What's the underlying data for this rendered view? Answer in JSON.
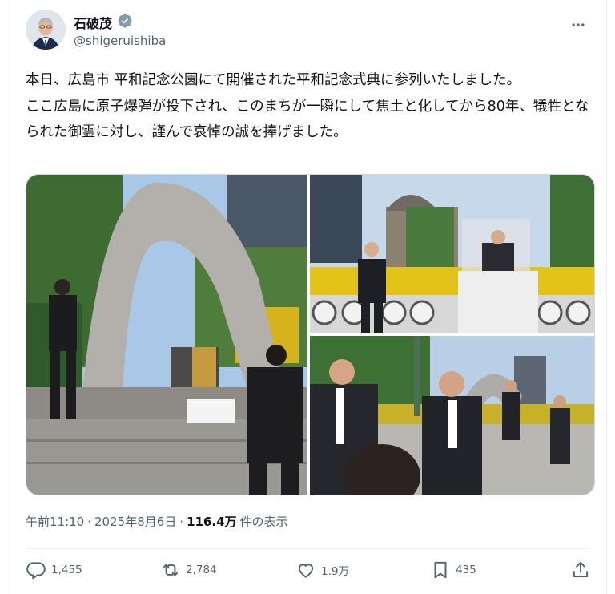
{
  "author": {
    "display_name": "石破茂",
    "handle": "@shigeruishiba",
    "verified_color": "#829aab",
    "avatar_icon": "profile-photo"
  },
  "tweet": {
    "text": "本日、広島市 平和記念公園にて開催された平和記念式典に参列いたしました。\nここ広島に原子爆弾が投下され、このまちが一瞬にして焦土と化してから80年、犠牲となられた御霊に対し、謹んで哀悼の誠を捧げました。",
    "photos": [
      {
        "icon": "memorial-cenotaph-photo"
      },
      {
        "icon": "podium-speech-photo"
      },
      {
        "icon": "walking-officials-photo"
      }
    ]
  },
  "meta": {
    "time": "午前11:10",
    "separator": "·",
    "date": "2025年8月6日",
    "views": "116.4万",
    "views_suffix": "件の表示"
  },
  "actions": {
    "reply_count": "1,455",
    "retweet_count": "2,784",
    "like_count": "1.9万",
    "bookmark_count": "435"
  },
  "colors": {
    "text": "#0f1419",
    "secondary": "#536471",
    "border": "#cfd9de"
  }
}
